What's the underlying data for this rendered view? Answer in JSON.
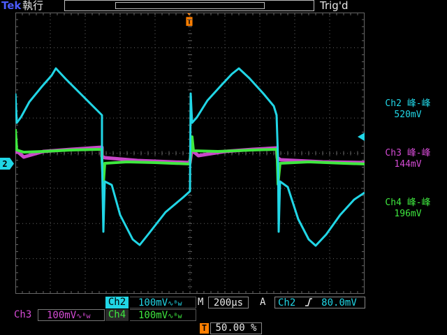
{
  "header": {
    "brand": "Tek",
    "run_status": "執行",
    "trigger_status": "Trig'd"
  },
  "markers": {
    "trigger_position": "T",
    "ch2_ground": "2"
  },
  "measurements": [
    {
      "label": "Ch2 峰-峰",
      "value": "520mV",
      "color": "#21d6e6"
    },
    {
      "label": "Ch3 峰-峰",
      "value": "144mV",
      "color": "#d44bd4"
    },
    {
      "label": "Ch4 峰-峰",
      "value": "196mV",
      "color": "#3fe83f"
    }
  ],
  "channels": {
    "ch2": {
      "label": "Ch2",
      "scale": "100mV",
      "coupling_icon": "∿ᴮw",
      "color": "#21d6e6"
    },
    "ch3": {
      "label": "Ch3",
      "scale": "100mV",
      "coupling_icon": "∿ᴮw",
      "color": "#d44bd4"
    },
    "ch4": {
      "label": "Ch4",
      "scale": "100mV",
      "coupling_icon": "∿ᴮw",
      "color": "#3fe83f"
    }
  },
  "horizontal": {
    "label": "M",
    "value": "200µs"
  },
  "trigger": {
    "mode": "A",
    "source": "Ch2",
    "slope_icon": "rising-edge-icon",
    "level": "80.0mV"
  },
  "trigger_position": {
    "icon": "T",
    "value": "50.00 %"
  },
  "colors": {
    "grid": "#666666",
    "accent_orange": "#ff7f00"
  }
}
